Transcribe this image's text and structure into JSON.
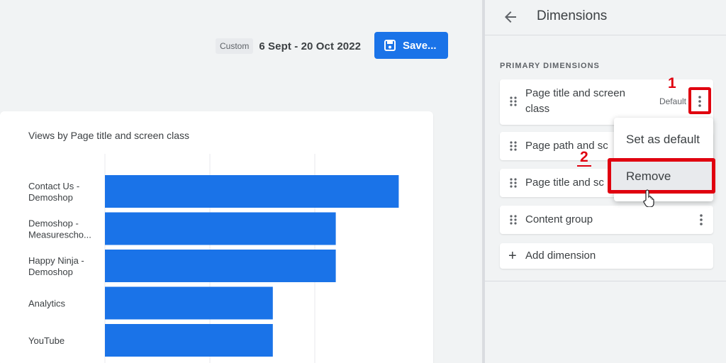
{
  "toolbar": {
    "custom_label": "Custom",
    "date_range": "6 Sept - 20 Oct 2022",
    "save_label": "Save...",
    "accent_color": "#1a73e8"
  },
  "card": {
    "title": "Views by Page title and screen class"
  },
  "chart_data": {
    "type": "bar",
    "orientation": "horizontal",
    "categories": [
      [
        "Contact Us -",
        "Demoshop"
      ],
      [
        "Demoshop -",
        "Measuresch o..."
      ],
      [
        "Happy Ninja -",
        "Demoshop"
      ],
      [
        "Analytics"
      ],
      [
        "YouTube"
      ]
    ],
    "values": [
      14,
      11,
      11,
      8,
      8
    ],
    "xlim": [
      0,
      15
    ],
    "grid": true,
    "bar_color": "#1a73e8"
  },
  "panel": {
    "title": "Dimensions",
    "section_label": "PRIMARY DIMENSIONS",
    "dimensions": [
      {
        "label_line1": "Page title and screen",
        "label_line2": "class",
        "tag": "Default"
      },
      {
        "label": "Page path and sc"
      },
      {
        "label": "Page title and sc"
      },
      {
        "label": "Content group"
      }
    ],
    "add_label": "Add dimension"
  },
  "menu": {
    "set_default": "Set as default",
    "remove": "Remove"
  },
  "annotations": {
    "step1": "1",
    "step2": "2",
    "color": "#e0000f"
  }
}
